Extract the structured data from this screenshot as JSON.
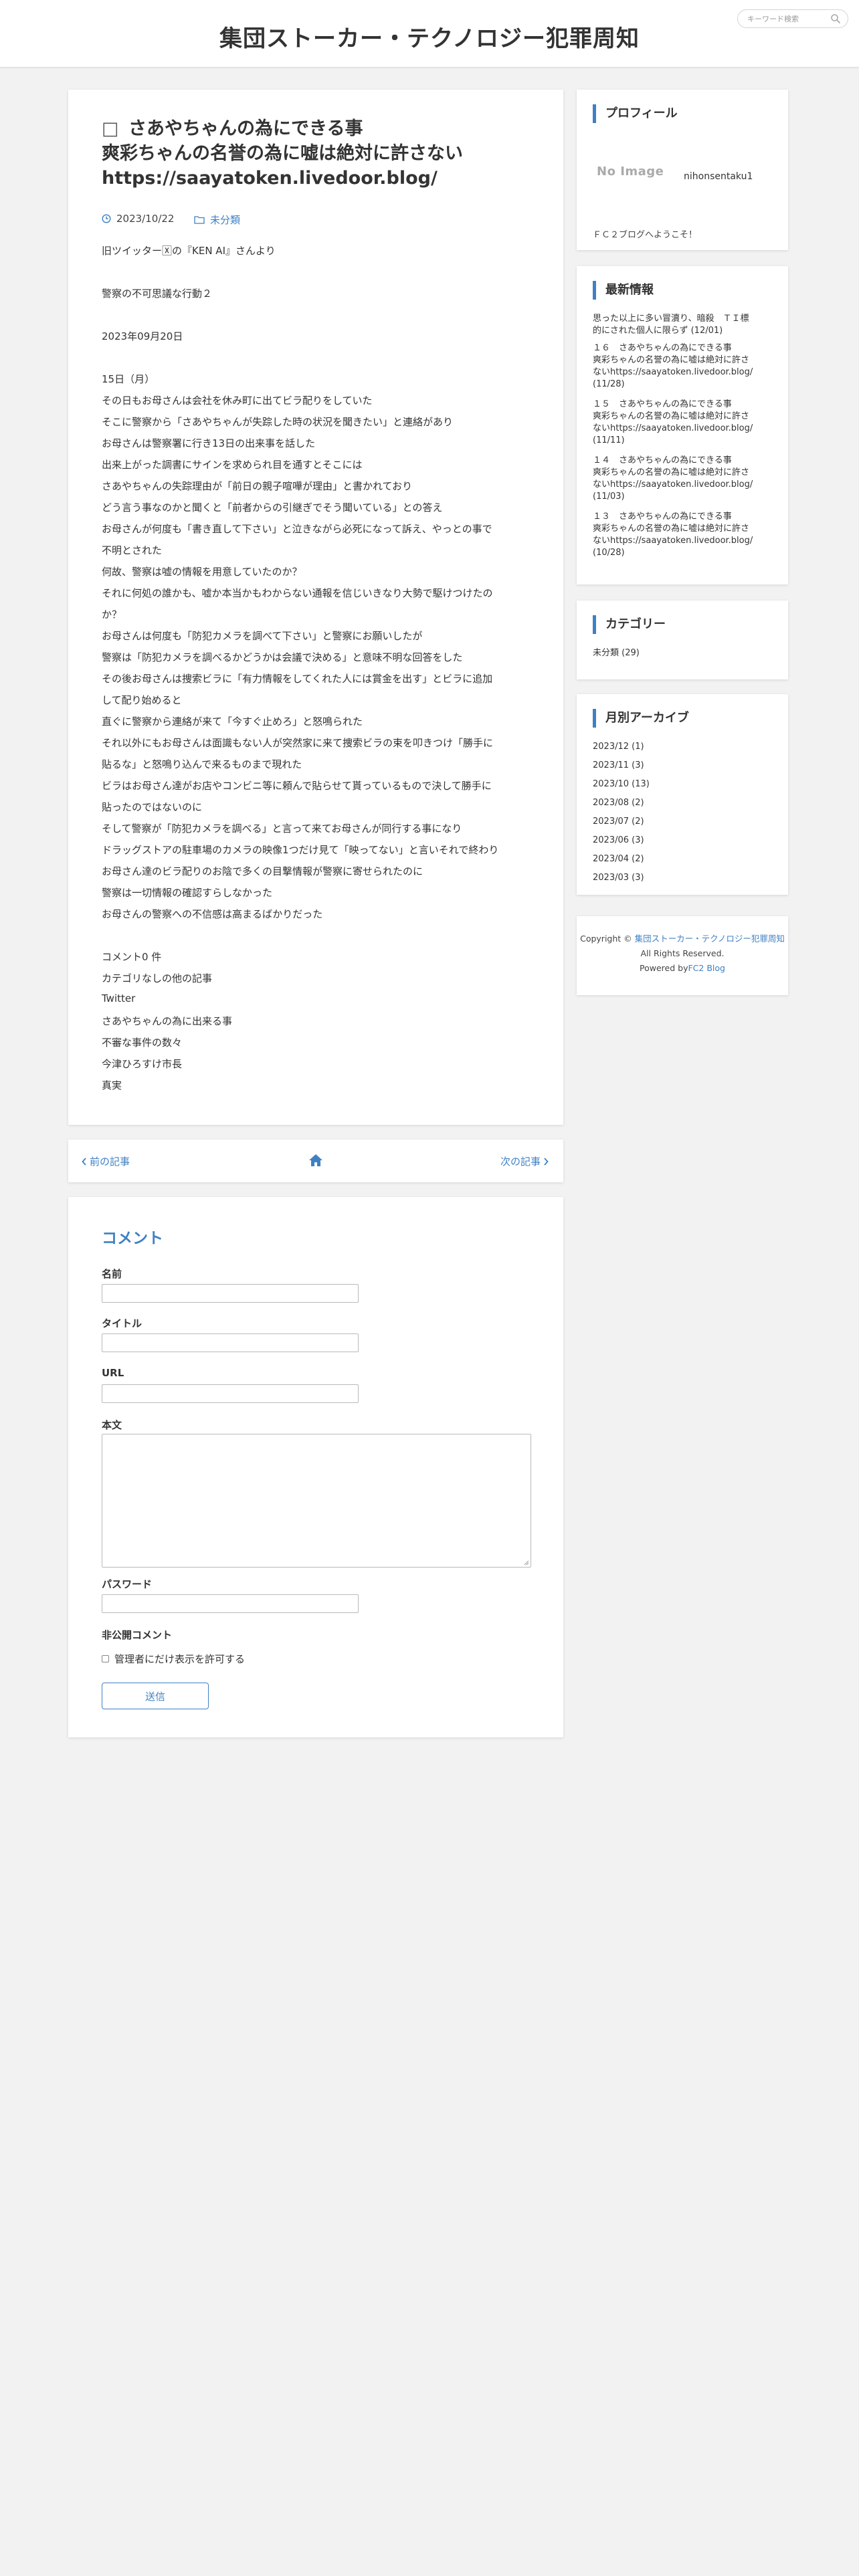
{
  "header": {
    "site_title": "集団ストーカー・テクノロジー犯罪周知",
    "search_placeholder": "キーワード検索"
  },
  "article": {
    "title_lines": [
      "さあやちゃんの為にできる事",
      "爽彩ちゃんの名誉の為に嘘は絶対に許さない",
      "https://saayatoken.livedoor.blog/"
    ],
    "date": "2023/10/22",
    "category": "未分類",
    "body": [
      "旧ツイッター🅇の『KEN AI』さんより",
      "",
      "警察の不可思議な行動２",
      "",
      "2023年09月20日",
      "",
      "15日（月）",
      "その日もお母さんは会社を休み町に出てビラ配りをしていた",
      "そこに警察から「さあやちゃんが失踪した時の状況を聞きたい」と連絡があり",
      "お母さんは警察署に行き13日の出来事を話した",
      "出来上がった調書にサインを求められ目を通すとそこには",
      "さあやちゃんの失踪理由が「前日の親子喧嘩が理由」と書かれており",
      "どう言う事なのかと聞くと「前者からの引継ぎでそう聞いている」との答え",
      "お母さんが何度も「書き直して下さい」と泣きながら必死になって訴え、やっとの事で",
      "不明とされた",
      "何故、警察は嘘の情報を用意していたのか？",
      "それに何処の誰かも、嘘か本当かもわからない通報を信じいきなり大勢で駆けつけたの",
      "か？",
      "お母さんは何度も「防犯カメラを調べて下さい」と警察にお願いしたが",
      "警察は「防犯カメラを調べるかどうかは会議で決める」と意味不明な回答をした",
      "その後お母さんは捜索ビラに「有力情報をしてくれた人には賞金を出す」とビラに追加",
      "して配り始めると",
      "直ぐに警察から連絡が来て「今すぐ止めろ」と怒鳴られた",
      "それ以外にもお母さんは面識もない人が突然家に来て捜索ビラの束を叩きつけ「勝手に",
      "貼るな」と怒鳴り込んで来るものまで現れた",
      "ビラはお母さん達がお店やコンビニ等に頼んで貼らせて貰っているもので決して勝手に",
      "貼ったのではないのに",
      "そして警察が「防犯カメラを調べる」と言って来てお母さんが同行する事になり",
      "ドラッグストアの駐車場のカメラの映像1つだけ見て「映ってない」と言いそれで終わり",
      "お母さん達のビラ配りのお陰で多くの目撃情報が警察に寄せられたのに",
      "警察は一切情報の確認すらしなかった",
      "お母さんの警察への不信感は高まるばかりだった",
      "",
      "コメント0 件",
      "カテゴリなしの他の記事",
      "Twitter",
      "さあやちゃんの為に出来る事",
      "不審な事件の数々",
      "今津ひろすけ市長",
      "真実"
    ]
  },
  "post_nav": {
    "prev_label": "前の記事",
    "next_label": "次の記事"
  },
  "comment_form": {
    "heading": "コメント",
    "name_label": "名前",
    "title_label": "タイトル",
    "url_label": "URL",
    "body_label": "本文",
    "password_label": "パスワード",
    "private_label": "非公開コメント",
    "private_checkbox_label": "管理者にだけ表示を許可する",
    "submit_label": "送信"
  },
  "sidebar": {
    "profile": {
      "heading": "プロフィール",
      "avatar_text": "No Image",
      "name": "nihonsentaku1",
      "text": "ＦＣ２ブログへようこそ！"
    },
    "recent": {
      "heading": "最新情報",
      "lines": [
        "思った以上に多い冒瀆り、暗殺　ＴＩ標",
        "的にされた個人に限らず (12/01)",
        "１６　さあやちゃんの為にできる事",
        "爽彩ちゃんの名誉の為に嘘は絶対に許さ",
        "ないhttps://saayatoken.livedoor.blog/",
        "(11/28)",
        "１５　さあやちゃんの為にできる事",
        "爽彩ちゃんの名誉の為に嘘は絶対に許さ",
        "ないhttps://saayatoken.livedoor.blog/",
        "(11/11)",
        "１４　さあやちゃんの為にできる事",
        "爽彩ちゃんの名誉の為に嘘は絶対に許さ",
        "ないhttps://saayatoken.livedoor.blog/",
        "(11/03)",
        "１３　さあやちゃんの為にできる事",
        "爽彩ちゃんの名誉の為に嘘は絶対に許さ",
        "ないhttps://saayatoken.livedoor.blog/",
        "(10/28)"
      ]
    },
    "categories": {
      "heading": "カテゴリー",
      "items": [
        "未分類 (29)"
      ]
    },
    "archive": {
      "heading": "月別アーカイブ",
      "items": [
        "2023/12 (1)",
        "2023/11 (3)",
        "2023/10 (13)",
        "2023/08 (2)",
        "2023/07 (2)",
        "2023/06 (3)",
        "2023/04 (2)",
        "2023/03 (3)"
      ]
    },
    "footer": {
      "copyright_prefix": "Copyright ©",
      "site_link": "集団ストーカー・テクノロジー犯罪周知",
      "rights": "All Rights Reserved.",
      "powered_prefix": "Powered by",
      "powered_link": "FC2 Blog"
    }
  },
  "colors": {
    "accent": "#3f80c4",
    "background": "#f2f2f2"
  }
}
